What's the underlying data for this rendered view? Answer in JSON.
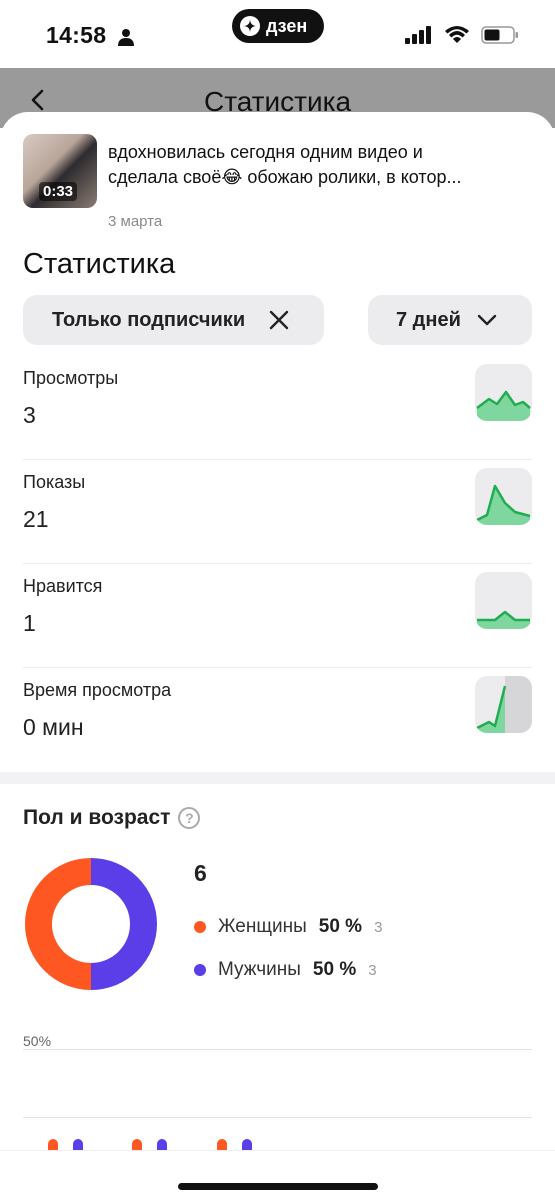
{
  "status_bar": {
    "time": "14:58",
    "app_badge": "дзен"
  },
  "nav": {
    "title": "Статистика"
  },
  "video": {
    "duration": "0:33",
    "caption_line1": "вдохновилась сегодня одним видео и",
    "caption_line2": "сделала своё😂 обожаю ролики, в котор...",
    "date": "3 марта"
  },
  "stats": {
    "heading": "Статистика",
    "filter_label": "Только подписчики",
    "period_label": "7 дней",
    "metrics": [
      {
        "label": "Просмотры",
        "value": "3"
      },
      {
        "label": "Показы",
        "value": "21"
      },
      {
        "label": "Нравится",
        "value": "1"
      },
      {
        "label": "Время просмотра",
        "value": "0 мин"
      }
    ]
  },
  "gender_age": {
    "heading": "Пол и возраст",
    "total": "6",
    "items": [
      {
        "label": "Женщины",
        "percent": "50 %",
        "count": "3",
        "color": "#ff5722"
      },
      {
        "label": "Мужчины",
        "percent": "50 %",
        "count": "3",
        "color": "#5b3ee8"
      }
    ],
    "axis_label": "50%"
  },
  "colors": {
    "accent_green": "#1fae4f",
    "female": "#ff5722",
    "male": "#5b3ee8"
  }
}
